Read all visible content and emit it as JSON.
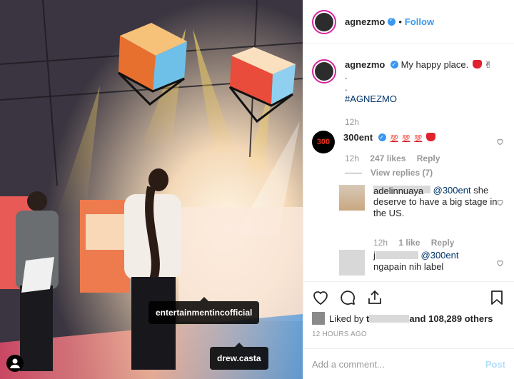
{
  "post": {
    "username": "agnezmo",
    "follow_label": "Follow",
    "dot": "•",
    "caption": {
      "text": "My happy place.",
      "line2": ".",
      "line3": ".",
      "hashtag": "#AGNEZMO",
      "time": "12h"
    },
    "photo_tags": [
      "entertainmentincofficial",
      "drew.casta"
    ]
  },
  "comments": [
    {
      "username": "300ent",
      "avatar_text": "300",
      "time": "12h",
      "likes": "247 likes",
      "reply_label": "Reply",
      "view_replies": "View replies (7)"
    },
    {
      "username": "adelinnuaya",
      "mention": "@300ent",
      "text": "she deserve to have a big stage in the US.",
      "time": "12h",
      "likes": "1 like",
      "reply_label": "Reply"
    },
    {
      "username": "j",
      "mention": "@300ent",
      "text": "ngapain nih label"
    }
  ],
  "footer": {
    "liked_prefix": "Liked by",
    "liked_user": "t",
    "liked_suffix": "and 108,289 others",
    "timestamp": "12 HOURS AGO",
    "add_comment_placeholder": "Add a comment...",
    "post_label": "Post"
  },
  "colors": {
    "accent": "#3897f0",
    "hashtag": "#003569",
    "muted": "#999999",
    "heart": "#e0222e"
  }
}
